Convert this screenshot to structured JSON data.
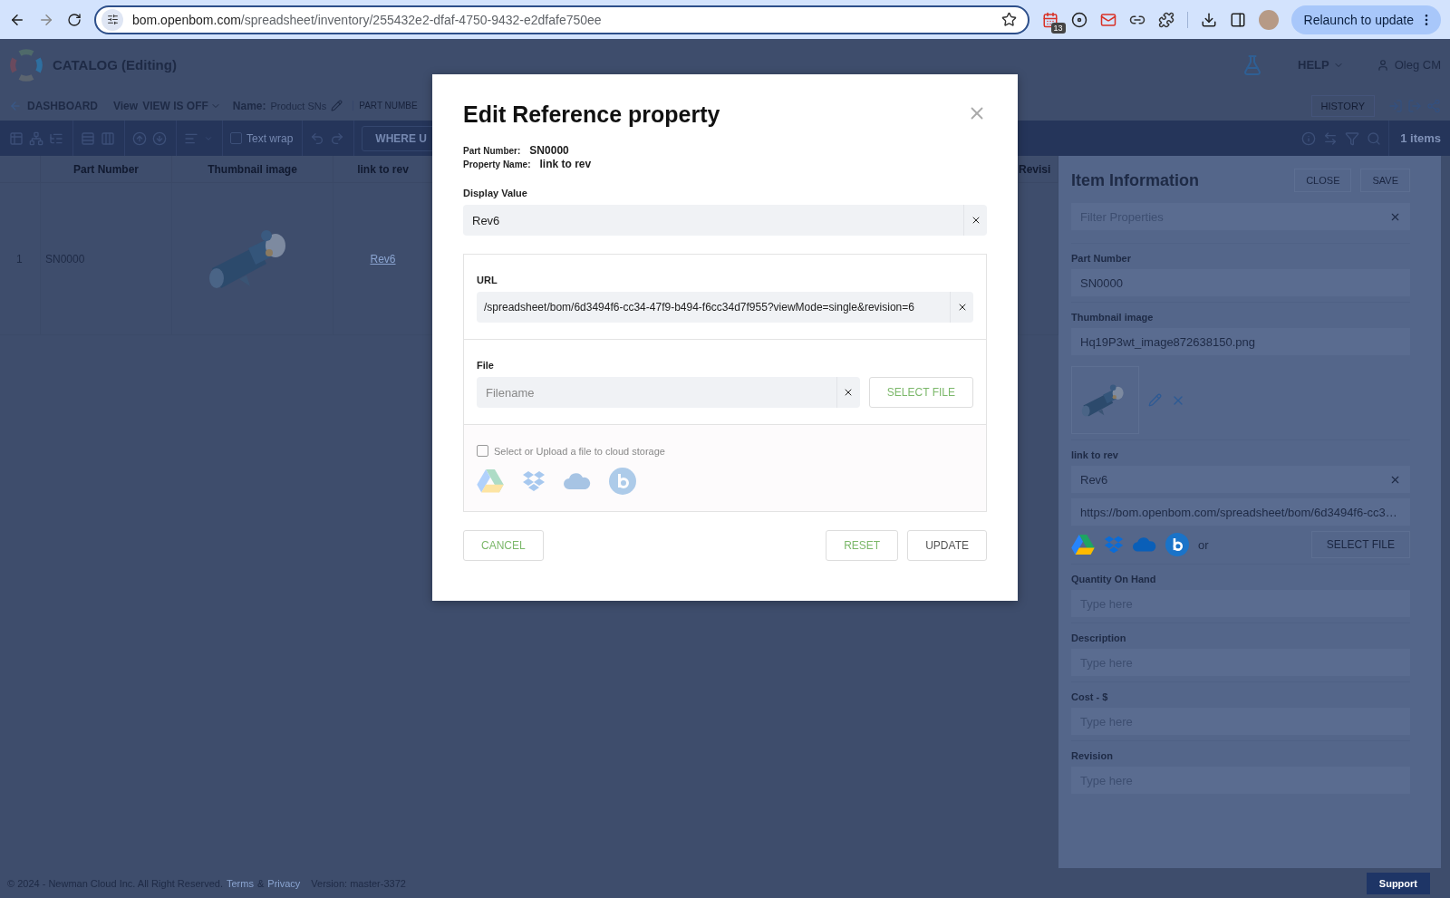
{
  "browser": {
    "url_host": "bom.openbom.com",
    "url_path": "/spreadsheet/inventory/255432e2-dfaf-4750-9432-e2dfafe750ee",
    "extension_badge": "13",
    "relaunch_button": "Relaunch to update"
  },
  "app_header": {
    "title": "CATALOG (Editing)",
    "help_menu": "HELP",
    "user": "Oleg CM"
  },
  "sub_bar": {
    "back_link": "DASHBOARD",
    "view_label": "View",
    "view_value": "VIEW IS OFF",
    "name_label": "Name:",
    "name_value": "Product SNs",
    "column_chip": "PART NUMBE",
    "history_button": "HISTORY"
  },
  "toolbar": {
    "text_wrap": {
      "label": "Text wrap",
      "checked": false
    },
    "where_button": "WHERE U",
    "item_count": "1 items"
  },
  "table": {
    "columns": [
      "Part Number",
      "Thumbnail image",
      "link to rev",
      "Revisi"
    ],
    "rows": [
      {
        "index": "1",
        "part_number": "SN0000",
        "link": "Rev6"
      }
    ]
  },
  "item_panel": {
    "title": "Item Information",
    "close_button": "CLOSE",
    "save_button": "SAVE",
    "filter_placeholder": "Filter Properties",
    "fields": [
      {
        "kind": "text",
        "label": "Part Number",
        "value": "SN0000"
      },
      {
        "label": "Thumbnail image",
        "value": "Hq19P3wt_image872638150.png"
      },
      {
        "kind": "reference",
        "label": "link to rev",
        "value": "Rev6",
        "url": "https://bom.openbom.com/spreadsheet/bom/6d3494f6-cc3…",
        "or_text": "or",
        "select_button": "SELECT FILE"
      },
      {
        "kind": "text",
        "label": "Quantity On Hand",
        "placeholder": "Type here"
      },
      {
        "kind": "text",
        "label": "Description",
        "placeholder": "Type here"
      },
      {
        "kind": "text",
        "label": "Cost - $",
        "placeholder": "Type here"
      },
      {
        "kind": "text",
        "label": "Revision",
        "placeholder": "Type here"
      }
    ]
  },
  "footer": {
    "copyright": "© 2024 - Newman Cloud Inc. All Right Reserved.",
    "terms_link": "Terms",
    "ampersand": "&",
    "privacy_link": "Privacy",
    "version": "Version: master-3372",
    "support_button": "Support"
  },
  "dialog": {
    "title": "Edit Reference property",
    "part_number_label": "Part Number:",
    "part_number": "SN0000",
    "property_name_label": "Property Name:",
    "property_name": "link to rev",
    "display_value_label": "Display Value",
    "display_value": "Rev6",
    "url_label": "URL",
    "url": "/spreadsheet/bom/6d3494f6-cc34-47f9-b494-f6cc34d7f955?viewMode=single&revision=6",
    "file_label": "File",
    "file_placeholder": "Filename",
    "select_file_button": "SELECT FILE",
    "cloud_checkbox": {
      "label": "Select or Upload a file to cloud storage",
      "checked": false
    },
    "cancel_button": "CANCEL",
    "reset_button": "RESET",
    "update_button": "UPDATE"
  }
}
